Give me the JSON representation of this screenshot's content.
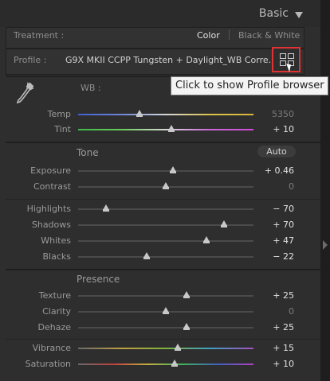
{
  "panel": {
    "title": "Basic"
  },
  "treatment": {
    "label": "Treatment :",
    "options": [
      "Color",
      "Black & White"
    ],
    "selected": "Color"
  },
  "profile": {
    "label": "Profile :",
    "value": "G9X MKII CCPP Tungsten + Daylight_WB Corre...",
    "browser_icon": "grid-icon",
    "tooltip": "Click to show Profile browser"
  },
  "wb": {
    "label": "WB :",
    "eyedropper_icon": "eyedropper-icon",
    "sliders": [
      {
        "name": "Temp",
        "value": "5350",
        "pos": 0.35,
        "track": "temp"
      },
      {
        "name": "Tint",
        "value": "+ 10",
        "pos": 0.53,
        "track": "tint"
      }
    ]
  },
  "tone": {
    "title": "Tone",
    "auto_label": "Auto",
    "sliders_a": [
      {
        "name": "Exposure",
        "value": "+ 0.46",
        "pos": 0.54
      },
      {
        "name": "Contrast",
        "value": "0",
        "pos": 0.5
      }
    ],
    "sliders_b": [
      {
        "name": "Highlights",
        "value": "− 70",
        "pos": 0.16
      },
      {
        "name": "Shadows",
        "value": "+ 70",
        "pos": 0.83
      },
      {
        "name": "Whites",
        "value": "+ 47",
        "pos": 0.73
      },
      {
        "name": "Blacks",
        "value": "− 22",
        "pos": 0.39
      }
    ]
  },
  "presence": {
    "title": "Presence",
    "sliders_a": [
      {
        "name": "Texture",
        "value": "+ 25",
        "pos": 0.62
      },
      {
        "name": "Clarity",
        "value": "0",
        "pos": 0.5
      },
      {
        "name": "Dehaze",
        "value": "+ 25",
        "pos": 0.62
      }
    ],
    "sliders_b": [
      {
        "name": "Vibrance",
        "value": "+ 15",
        "pos": 0.57,
        "track": "vib"
      },
      {
        "name": "Saturation",
        "value": "+ 10",
        "pos": 0.55,
        "track": "sat"
      }
    ]
  }
}
